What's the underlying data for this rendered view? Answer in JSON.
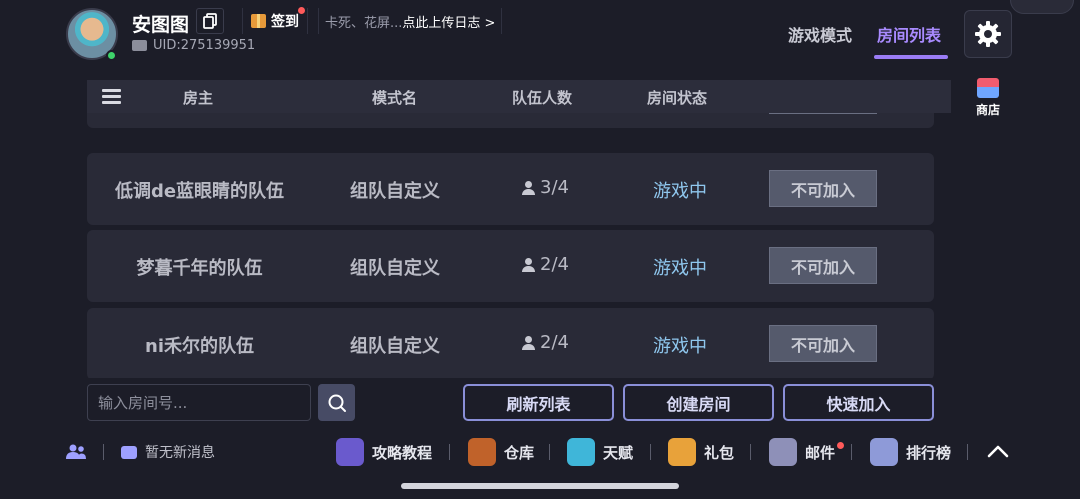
{
  "user": {
    "name": "安图图",
    "uid": "UID:275139951"
  },
  "header": {
    "checkin_label": "签到",
    "notice_prefix": "卡死、花屏...",
    "notice_link": "点此上传日志 >",
    "tabs": [
      {
        "label": "游戏模式",
        "active": false
      },
      {
        "label": "房间列表",
        "active": true
      }
    ],
    "shop_label": "商店",
    "accent_color": "#9a7cf5"
  },
  "table": {
    "headers": [
      "房主",
      "模式名",
      "队伍人数",
      "房间状态"
    ],
    "rows": [
      {
        "owner": "低调de蓝眼睛的队伍",
        "mode": "组队自定义",
        "members": "3/4",
        "status": "游戏中",
        "action": "不可加入"
      },
      {
        "owner": "梦暮千年的队伍",
        "mode": "组队自定义",
        "members": "2/4",
        "status": "游戏中",
        "action": "不可加入"
      },
      {
        "owner": "ni禾尔的队伍",
        "mode": "组队自定义",
        "members": "2/4",
        "status": "游戏中",
        "action": "不可加入"
      }
    ]
  },
  "controls": {
    "room_input_placeholder": "输入房间号...",
    "refresh_label": "刷新列表",
    "create_label": "创建房间",
    "quick_join_label": "快速加入"
  },
  "bottom_bar": {
    "message_text": "暂无新消息",
    "nav": [
      {
        "label": "攻略教程",
        "icon": "guide-book-icon",
        "color": "#6a5acd"
      },
      {
        "label": "仓库",
        "icon": "warehouse-icon",
        "color": "#c0622a"
      },
      {
        "label": "天赋",
        "icon": "talent-icon",
        "color": "#3fb6d9"
      },
      {
        "label": "礼包",
        "icon": "gift-pack-icon",
        "color": "#e8a23a"
      },
      {
        "label": "邮件",
        "icon": "mail-icon",
        "color": "#8e90b8"
      },
      {
        "label": "排行榜",
        "icon": "ranking-icon",
        "color": "#8e9ad8"
      }
    ]
  }
}
